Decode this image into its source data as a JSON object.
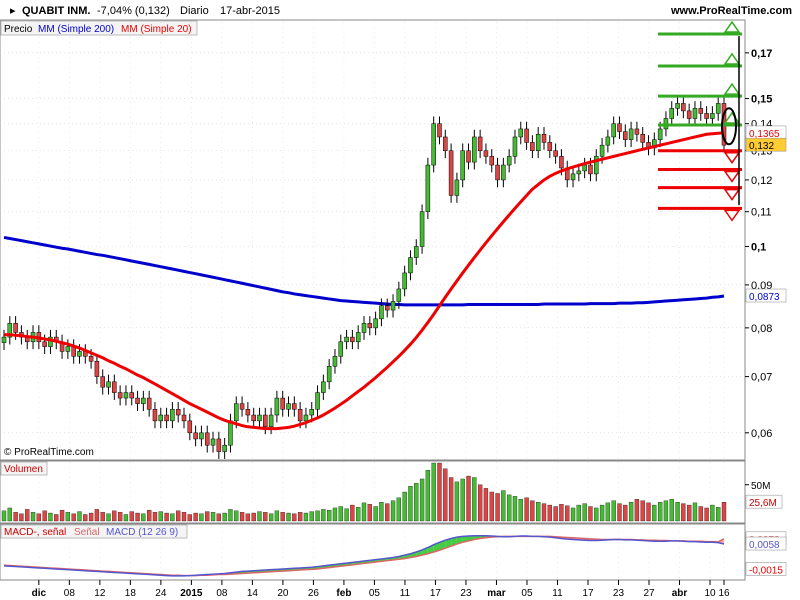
{
  "header": {
    "symbol": "QUABIT INM.",
    "change": "-7,04% (0,132)",
    "period": "Diario",
    "date": "17-abr-2015",
    "site": "www.ProRealTime.com",
    "copyright": "© ProRealTime.com"
  },
  "colors": {
    "up": "#44bb33",
    "down": "#dd4444",
    "ma200": "#0000cc",
    "ma20": "#ee0000",
    "resistance": "#33aa22",
    "support": "#ee0000",
    "macd": "#5555cc",
    "signal": "#dd6666",
    "hist_pos": "#44cc44",
    "hist_neg": "#ffaaaa",
    "grid": "#cccccc"
  },
  "chart_data": [
    {
      "type": "candlestick",
      "panel": "price",
      "legend": [
        "Precio",
        "MM (Simple 200)",
        "MM (Simple 20)"
      ],
      "ylim": [
        0.056,
        0.185
      ],
      "yscale": "log",
      "y_ticks": [
        "0,17",
        "0,15",
        "0,14",
        "0,13",
        "0,12",
        "0,11",
        "0,1",
        "0,09",
        "0,08",
        "0,07",
        "0,06"
      ],
      "y_tick_values": [
        0.17,
        0.15,
        0.14,
        0.13,
        0.12,
        0.11,
        0.1,
        0.09,
        0.08,
        0.07,
        0.06
      ],
      "x_ticks": [
        "dic",
        "08",
        "12",
        "18",
        "24",
        "2015",
        "08",
        "14",
        "20",
        "26",
        "feb",
        "05",
        "11",
        "17",
        "23",
        "mar",
        "05",
        "11",
        "17",
        "23",
        "27",
        "abr",
        "10",
        "16"
      ],
      "x_tick_bold": [
        "dic",
        "2015",
        "feb",
        "mar",
        "abr"
      ],
      "price_labels": [
        {
          "text": "0,1365",
          "value": 0.1365
        },
        {
          "text": "0,132",
          "value": 0.132
        },
        {
          "text": "0,0873",
          "value": 0.0873
        }
      ],
      "resistance_levels": [
        0.179,
        0.164,
        0.151,
        0.1395
      ],
      "support_levels": [
        0.13,
        0.1235,
        0.1175,
        0.111
      ],
      "close": [
        0.078,
        0.081,
        0.079,
        0.078,
        0.077,
        0.079,
        0.077,
        0.076,
        0.078,
        0.077,
        0.075,
        0.076,
        0.074,
        0.075,
        0.074,
        0.073,
        0.07,
        0.068,
        0.069,
        0.067,
        0.066,
        0.067,
        0.066,
        0.065,
        0.066,
        0.064,
        0.062,
        0.063,
        0.062,
        0.064,
        0.063,
        0.062,
        0.06,
        0.059,
        0.06,
        0.058,
        0.059,
        0.057,
        0.058,
        0.062,
        0.065,
        0.064,
        0.063,
        0.062,
        0.063,
        0.061,
        0.063,
        0.066,
        0.064,
        0.065,
        0.064,
        0.062,
        0.063,
        0.064,
        0.067,
        0.069,
        0.072,
        0.074,
        0.077,
        0.078,
        0.077,
        0.079,
        0.081,
        0.08,
        0.082,
        0.085,
        0.084,
        0.086,
        0.089,
        0.093,
        0.097,
        0.1,
        0.11,
        0.125,
        0.14,
        0.135,
        0.13,
        0.115,
        0.12,
        0.13,
        0.126,
        0.135,
        0.13,
        0.128,
        0.125,
        0.12,
        0.125,
        0.128,
        0.135,
        0.138,
        0.133,
        0.13,
        0.136,
        0.133,
        0.13,
        0.128,
        0.124,
        0.12,
        0.122,
        0.123,
        0.125,
        0.122,
        0.128,
        0.132,
        0.135,
        0.14,
        0.137,
        0.134,
        0.138,
        0.136,
        0.133,
        0.131,
        0.134,
        0.138,
        0.142,
        0.146,
        0.148,
        0.145,
        0.142,
        0.146,
        0.144,
        0.142,
        0.144,
        0.148,
        0.132
      ],
      "ma200": [
        0.1025,
        0.1022,
        0.1019,
        0.1016,
        0.1013,
        0.101,
        0.1007,
        0.1004,
        0.1001,
        0.0998,
        0.0995,
        0.0993,
        0.099,
        0.0987,
        0.0984,
        0.0981,
        0.0978,
        0.0976,
        0.0973,
        0.097,
        0.0967,
        0.0964,
        0.0961,
        0.0958,
        0.0955,
        0.0952,
        0.0949,
        0.0946,
        0.0943,
        0.094,
        0.0937,
        0.0934,
        0.0931,
        0.0928,
        0.0925,
        0.0922,
        0.0919,
        0.0916,
        0.0913,
        0.091,
        0.0907,
        0.0904,
        0.0901,
        0.0898,
        0.0895,
        0.0892,
        0.0889,
        0.0886,
        0.0883,
        0.0881,
        0.0878,
        0.0876,
        0.0874,
        0.0872,
        0.087,
        0.0868,
        0.0866,
        0.0864,
        0.0862,
        0.0861,
        0.086,
        0.0859,
        0.0858,
        0.0857,
        0.0856,
        0.0855,
        0.0854,
        0.0853,
        0.0853,
        0.0852,
        0.0852,
        0.0852,
        0.0852,
        0.0852,
        0.0852,
        0.0852,
        0.0852,
        0.0852,
        0.0852,
        0.0852,
        0.0853,
        0.0853,
        0.0853,
        0.0853,
        0.0853,
        0.0853,
        0.0853,
        0.0853,
        0.0853,
        0.0853,
        0.0853,
        0.0853,
        0.0853,
        0.0854,
        0.0854,
        0.0854,
        0.0854,
        0.0854,
        0.0854,
        0.0854,
        0.0854,
        0.0855,
        0.0855,
        0.0855,
        0.0855,
        0.0855,
        0.0856,
        0.0856,
        0.0856,
        0.0857,
        0.0857,
        0.0858,
        0.0859,
        0.086,
        0.0861,
        0.0862,
        0.0863,
        0.0864,
        0.0865,
        0.0866,
        0.0867,
        0.0868,
        0.087,
        0.0871,
        0.0873
      ],
      "ma20": [
        0.0785,
        0.0785,
        0.0784,
        0.0783,
        0.0781,
        0.078,
        0.0778,
        0.0776,
        0.0774,
        0.0771,
        0.0768,
        0.0765,
        0.0761,
        0.0757,
        0.0752,
        0.0747,
        0.0742,
        0.0737,
        0.0731,
        0.0726,
        0.072,
        0.0715,
        0.0709,
        0.0703,
        0.0698,
        0.0692,
        0.0686,
        0.068,
        0.0674,
        0.0668,
        0.0662,
        0.0656,
        0.065,
        0.0645,
        0.064,
        0.0635,
        0.063,
        0.0625,
        0.0621,
        0.0618,
        0.0615,
        0.0612,
        0.061,
        0.0609,
        0.0608,
        0.0607,
        0.0607,
        0.0607,
        0.0608,
        0.0609,
        0.0611,
        0.0614,
        0.0617,
        0.0621,
        0.0625,
        0.063,
        0.0636,
        0.0642,
        0.0649,
        0.0656,
        0.0664,
        0.0672,
        0.068,
        0.0689,
        0.0698,
        0.0708,
        0.0718,
        0.0729,
        0.074,
        0.0752,
        0.0765,
        0.0779,
        0.0795,
        0.0812,
        0.083,
        0.085,
        0.087,
        0.089,
        0.091,
        0.093,
        0.095,
        0.097,
        0.099,
        0.101,
        0.103,
        0.105,
        0.107,
        0.109,
        0.111,
        0.113,
        0.115,
        0.117,
        0.1185,
        0.12,
        0.1212,
        0.1222,
        0.123,
        0.1237,
        0.1243,
        0.1249,
        0.1255,
        0.126,
        0.1265,
        0.127,
        0.1275,
        0.128,
        0.1285,
        0.129,
        0.1295,
        0.13,
        0.1305,
        0.131,
        0.1315,
        0.132,
        0.1325,
        0.133,
        0.1335,
        0.134,
        0.1345,
        0.135,
        0.1355,
        0.136,
        0.1362,
        0.1364,
        0.1365
      ]
    },
    {
      "type": "bar",
      "panel": "volume",
      "legend": [
        "Volumen"
      ],
      "y_ticks": [
        "50M"
      ],
      "y_tick_values": [
        50
      ],
      "last_label": "25,6M",
      "ylim": [
        0,
        80
      ],
      "values": [
        14,
        18,
        12,
        10,
        16,
        12,
        10,
        14,
        11,
        9,
        15,
        12,
        10,
        13,
        9,
        11,
        16,
        12,
        10,
        14,
        12,
        9,
        13,
        11,
        10,
        15,
        12,
        13,
        11,
        10,
        14,
        12,
        9,
        11,
        10,
        13,
        12,
        10,
        11,
        16,
        14,
        12,
        10,
        11,
        13,
        12,
        10,
        14,
        12,
        11,
        10,
        12,
        11,
        13,
        14,
        16,
        15,
        18,
        20,
        17,
        22,
        19,
        25,
        23,
        20,
        26,
        24,
        28,
        32,
        40,
        48,
        52,
        58,
        70,
        85,
        80,
        72,
        60,
        54,
        58,
        62,
        60,
        50,
        45,
        40,
        38,
        42,
        36,
        34,
        30,
        32,
        28,
        26,
        24,
        22,
        20,
        23,
        21,
        18,
        22,
        24,
        20,
        18,
        22,
        25,
        28,
        24,
        22,
        26,
        30,
        28,
        25,
        22,
        26,
        28,
        30,
        26,
        24,
        22,
        25,
        20,
        18,
        22,
        19,
        26
      ]
    },
    {
      "type": "line",
      "panel": "macd",
      "legend": [
        "MACD-, señal",
        "Señal",
        "MACD (12 26 9)"
      ],
      "y_labels": [
        {
          "text": "0,0073",
          "value": 0.0073
        },
        {
          "text": "0,0058",
          "value": 0.0058
        },
        {
          "text": "-0,0015",
          "value": -0.0015
        }
      ],
      "ylim": [
        -0.004,
        0.011
      ],
      "macd": [
        -0.0005,
        -0.0006,
        -0.0007,
        -0.0008,
        -0.0009,
        -0.001,
        -0.0011,
        -0.0012,
        -0.0013,
        -0.0014,
        -0.0015,
        -0.0016,
        -0.0017,
        -0.0018,
        -0.0019,
        -0.002,
        -0.0021,
        -0.0022,
        -0.0023,
        -0.0024,
        -0.0025,
        -0.0026,
        -0.0027,
        -0.0028,
        -0.0029,
        -0.003,
        -0.0031,
        -0.0032,
        -0.0033,
        -0.0034,
        -0.0034,
        -0.0034,
        -0.0033,
        -0.0032,
        -0.0031,
        -0.003,
        -0.0029,
        -0.0028,
        -0.0027,
        -0.0025,
        -0.0023,
        -0.0021,
        -0.002,
        -0.0019,
        -0.0018,
        -0.0017,
        -0.0016,
        -0.0015,
        -0.0014,
        -0.0013,
        -0.0012,
        -0.0011,
        -0.001,
        -0.0009,
        -0.0007,
        -0.0005,
        -0.0003,
        -0.0001,
        0.0001,
        0.0003,
        0.0005,
        0.0007,
        0.0009,
        0.0011,
        0.0013,
        0.0015,
        0.0017,
        0.0019,
        0.0022,
        0.0026,
        0.003,
        0.0035,
        0.0041,
        0.0048,
        0.0056,
        0.0063,
        0.0069,
        0.0074,
        0.0078,
        0.008,
        0.0081,
        0.0082,
        0.0082,
        0.0082,
        0.0081,
        0.008,
        0.0079,
        0.0079,
        0.008,
        0.0081,
        0.0081,
        0.008,
        0.008,
        0.0079,
        0.0078,
        0.0076,
        0.0074,
        0.0072,
        0.0071,
        0.007,
        0.0069,
        0.0068,
        0.0068,
        0.0069,
        0.007,
        0.0071,
        0.0071,
        0.007,
        0.007,
        0.0069,
        0.0068,
        0.0067,
        0.0066,
        0.0066,
        0.0066,
        0.0067,
        0.0067,
        0.0066,
        0.0065,
        0.0065,
        0.0064,
        0.0063,
        0.0063,
        0.0062,
        0.0058
      ],
      "signal": [
        -0.0003,
        -0.0004,
        -0.0005,
        -0.0006,
        -0.0007,
        -0.0008,
        -0.0009,
        -0.001,
        -0.0011,
        -0.0012,
        -0.0013,
        -0.0014,
        -0.0015,
        -0.0016,
        -0.0017,
        -0.0018,
        -0.0019,
        -0.002,
        -0.0021,
        -0.0022,
        -0.0023,
        -0.0024,
        -0.0025,
        -0.0026,
        -0.0027,
        -0.0028,
        -0.0029,
        -0.003,
        -0.0031,
        -0.0032,
        -0.0032,
        -0.0033,
        -0.0033,
        -0.0033,
        -0.0032,
        -0.0032,
        -0.0031,
        -0.003,
        -0.003,
        -0.0029,
        -0.0028,
        -0.0027,
        -0.0026,
        -0.0025,
        -0.0024,
        -0.0023,
        -0.0022,
        -0.0021,
        -0.002,
        -0.0019,
        -0.0018,
        -0.0017,
        -0.0016,
        -0.0015,
        -0.0014,
        -0.0012,
        -0.001,
        -0.0008,
        -0.0006,
        -0.0004,
        -0.0002,
        0,
        0.0002,
        0.0004,
        0.0006,
        0.0008,
        0.001,
        0.0012,
        0.0014,
        0.0016,
        0.0019,
        0.0022,
        0.0026,
        0.003,
        0.0035,
        0.004,
        0.0046,
        0.0052,
        0.0058,
        0.0063,
        0.0067,
        0.0071,
        0.0074,
        0.0076,
        0.0078,
        0.0079,
        0.008,
        0.008,
        0.008,
        0.008,
        0.008,
        0.008,
        0.008,
        0.008,
        0.008,
        0.0079,
        0.0078,
        0.0077,
        0.0076,
        0.0075,
        0.0074,
        0.0073,
        0.0072,
        0.0071,
        0.0071,
        0.0071,
        0.0071,
        0.0071,
        0.0071,
        0.007,
        0.007,
        0.0069,
        0.0069,
        0.0068,
        0.0068,
        0.0067,
        0.0067,
        0.0067,
        0.0066,
        0.0066,
        0.0066,
        0.0065,
        0.0065,
        0.0064,
        0.0073
      ]
    }
  ]
}
